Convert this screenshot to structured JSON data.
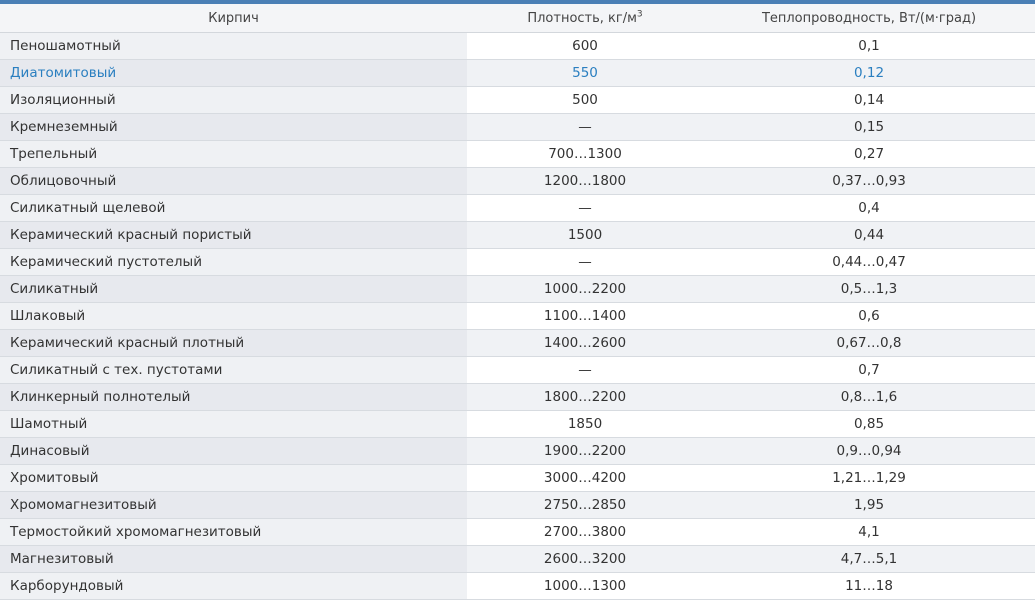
{
  "header": {
    "col_brick": "Кирпич",
    "col_density": "Плотность, кг/м",
    "col_density_sup": "3",
    "col_conductivity": "Теплопроводность, Вт/(м·град)"
  },
  "highlight_color": "#2a7fc0",
  "rows": [
    {
      "name": "Пеношамотный",
      "density": "600",
      "conductivity": "0,1"
    },
    {
      "name": "Диатомитовый",
      "density": "550",
      "conductivity": "0,12"
    },
    {
      "name": "Изоляционный",
      "density": "500",
      "conductivity": "0,14"
    },
    {
      "name": "Кремнеземный",
      "density": "—",
      "conductivity": "0,15"
    },
    {
      "name": "Трепельный",
      "density": "700…1300",
      "conductivity": "0,27"
    },
    {
      "name": "Облицовочный",
      "density": "1200…1800",
      "conductivity": "0,37…0,93"
    },
    {
      "name": "Силикатный щелевой",
      "density": "—",
      "conductivity": "0,4"
    },
    {
      "name": "Керамический красный пористый",
      "density": "1500",
      "conductivity": "0,44"
    },
    {
      "name": "Керамический пустотелый",
      "density": "—",
      "conductivity": "0,44…0,47"
    },
    {
      "name": "Силикатный",
      "density": "1000…2200",
      "conductivity": "0,5…1,3"
    },
    {
      "name": "Шлаковый",
      "density": "1100…1400",
      "conductivity": "0,6"
    },
    {
      "name": "Керамический красный плотный",
      "density": "1400…2600",
      "conductivity": "0,67…0,8"
    },
    {
      "name": "Силикатный с тех. пустотами",
      "density": "—",
      "conductivity": "0,7"
    },
    {
      "name": "Клинкерный полнотелый",
      "density": "1800…2200",
      "conductivity": "0,8…1,6"
    },
    {
      "name": "Шамотный",
      "density": "1850",
      "conductivity": "0,85"
    },
    {
      "name": "Динасовый",
      "density": "1900…2200",
      "conductivity": "0,9…0,94"
    },
    {
      "name": "Хромитовый",
      "density": "3000…4200",
      "conductivity": "1,21…1,29"
    },
    {
      "name": "Хромомагнезитовый",
      "density": "2750…2850",
      "conductivity": "1,95"
    },
    {
      "name": "Термостойкий хромомагнезитовый",
      "density": "2700…3800",
      "conductivity": "4,1"
    },
    {
      "name": "Магнезитовый",
      "density": "2600…3200",
      "conductivity": "4,7…5,1"
    },
    {
      "name": "Карборундовый",
      "density": "1000…1300",
      "conductivity": "11…18"
    }
  ]
}
